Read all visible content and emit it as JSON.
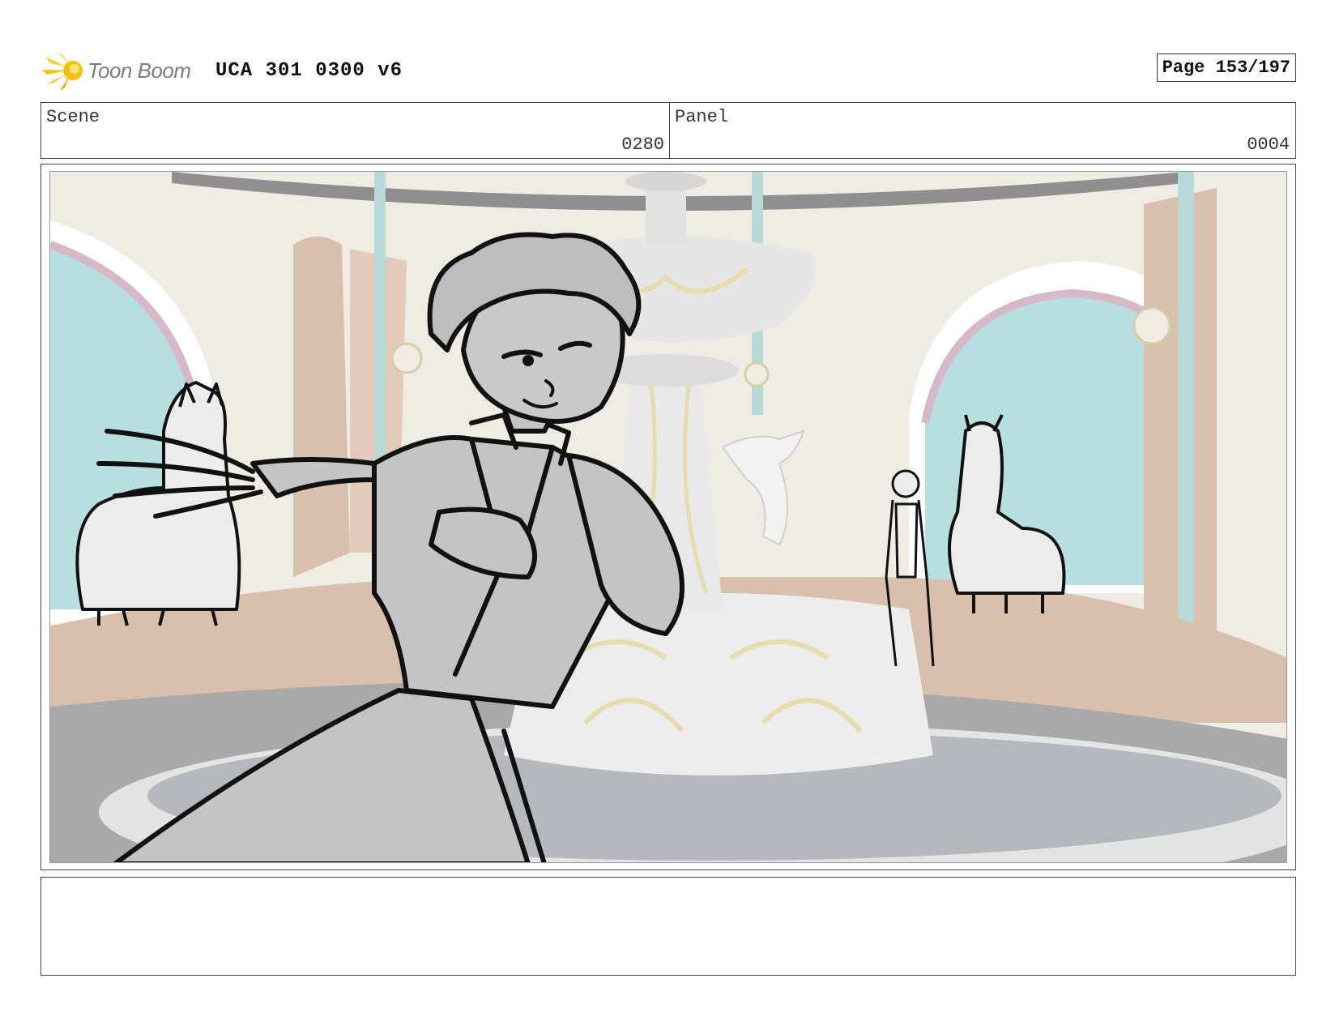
{
  "header": {
    "logo_text": "Toon Boom",
    "doc_title": "UCA 301 0300 v6",
    "page_label": "Page 153/197"
  },
  "info": {
    "scene_label": "Scene",
    "scene_value": "0280",
    "panel_label": "Panel",
    "panel_value": "0004"
  },
  "icons": {
    "logo": "toon-boom-star-burst-icon"
  },
  "colors": {
    "logo_yellow": "#f4c20d",
    "logo_text": "#7d7d7d",
    "wall": "#efece3",
    "window_glass": "#b8dfe0",
    "wood": "#d9bfae",
    "fountain": "#e9e9e9",
    "gold_trim": "#e6dcb0",
    "sketch_fill": "#c4c4c4"
  },
  "notes": {
    "text": ""
  }
}
